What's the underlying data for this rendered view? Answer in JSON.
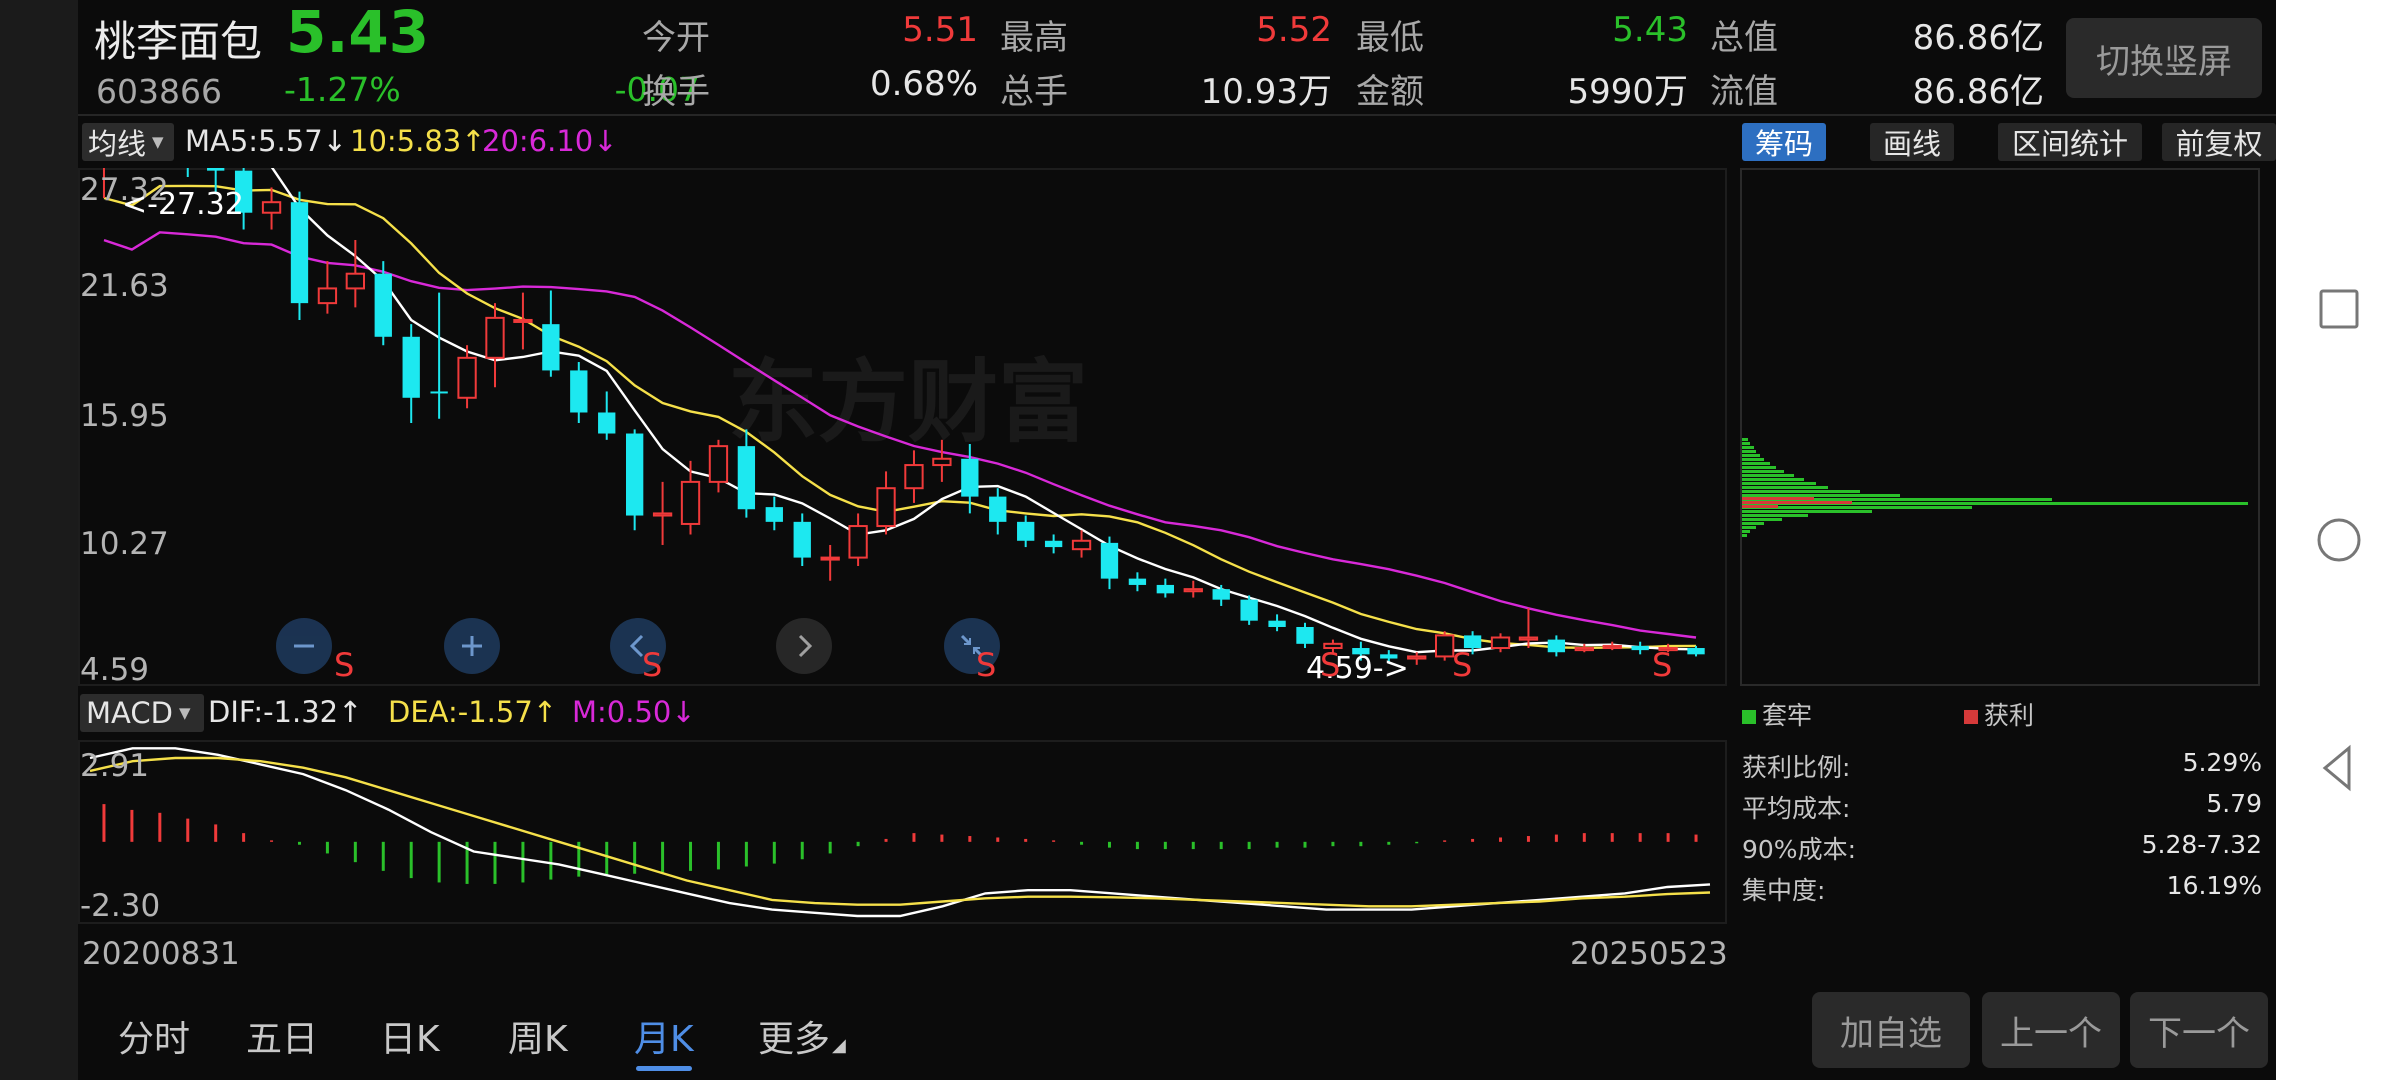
{
  "header": {
    "stock_name": "桃李面包",
    "stock_code": "603866",
    "price": "5.43",
    "change_pct": "-1.27%",
    "change_abs": "-0.07",
    "stats": [
      {
        "label": "今开",
        "value": "5.51",
        "color": "red"
      },
      {
        "label": "最高",
        "value": "5.52",
        "color": "red"
      },
      {
        "label": "最低",
        "value": "5.43",
        "color": "green"
      },
      {
        "label": "总值",
        "value": "86.86亿",
        "color": "white"
      },
      {
        "label": "换手",
        "value": "0.68%",
        "color": "white"
      },
      {
        "label": "总手",
        "value": "10.93万",
        "color": "white"
      },
      {
        "label": "金额",
        "value": "5990万",
        "color": "white"
      },
      {
        "label": "流值",
        "value": "86.86亿",
        "color": "white"
      }
    ],
    "switch_button": "切换竖屏"
  },
  "ma_bar": {
    "dropdown": "均线",
    "ma5": "MA5:5.57↓",
    "ma10": "10:5.83↑",
    "ma20": "20:6.10↓"
  },
  "right_tabs": [
    "筹码",
    "画线",
    "区间统计",
    "前复权"
  ],
  "main_chart": {
    "y_labels": [
      "27.32",
      "21.63",
      "15.95",
      "10.27",
      "4.59"
    ],
    "max_marker": "<-27.32",
    "min_marker": "4.59->",
    "watermark": "东方财富",
    "s_marker": "S"
  },
  "macd_bar": {
    "dropdown": "MACD",
    "dif": "DIF:-1.32↑",
    "dea": "DEA:-1.57↑",
    "m": "M:0.50↓"
  },
  "macd_chart": {
    "y_labels": [
      "2.91",
      "-2.30"
    ]
  },
  "x_axis": {
    "start": "20200831",
    "end": "20250523"
  },
  "chip_legend": {
    "trapped": "套牢",
    "profit": "获利"
  },
  "chip_stats": [
    {
      "label": "获利比例:",
      "value": "5.29%"
    },
    {
      "label": "平均成本:",
      "value": "5.79"
    },
    {
      "label": "90%成本:",
      "value": "5.28-7.32"
    },
    {
      "label": "集中度:",
      "value": "16.19%"
    }
  ],
  "bottom_tabs": [
    "分时",
    "五日",
    "日K",
    "周K",
    "月K",
    "更多"
  ],
  "bottom_buttons": [
    "加自选",
    "上一个",
    "下一个"
  ],
  "colors": {
    "up": "#f03a3a",
    "down": "#1de8f0",
    "ma5": "#ffffff",
    "ma10": "#f5e04a",
    "ma20": "#d829d8",
    "accent": "#2d6fc1",
    "chip_green": "#2ac02a",
    "chip_red": "#d63a3a"
  }
}
